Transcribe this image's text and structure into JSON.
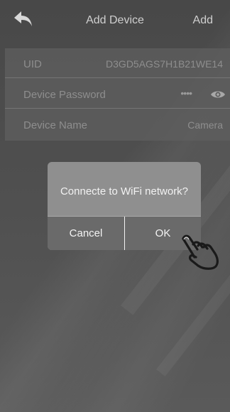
{
  "header": {
    "title": "Add Device",
    "add_label": "Add",
    "back_icon": "back-arrow-icon"
  },
  "form": {
    "uid": {
      "label": "UID",
      "value": "D3GD5AGS7H1B21WE14"
    },
    "password": {
      "label": "Device Password",
      "value": "••••",
      "toggle_icon": "eye-icon"
    },
    "name": {
      "label": "Device Name",
      "value": "Camera"
    }
  },
  "dialog": {
    "message": "Connecte to WiFi network?",
    "cancel_label": "Cancel",
    "ok_label": "OK",
    "pointer_icon": "pointing-hand-icon"
  },
  "colors": {
    "background": "#4a4a4a",
    "dialog_body": "#8f8f8f",
    "dialog_buttons": "#6a6a6a",
    "text_light": "#f2f2f2",
    "text_muted": "#8e8e8e"
  }
}
